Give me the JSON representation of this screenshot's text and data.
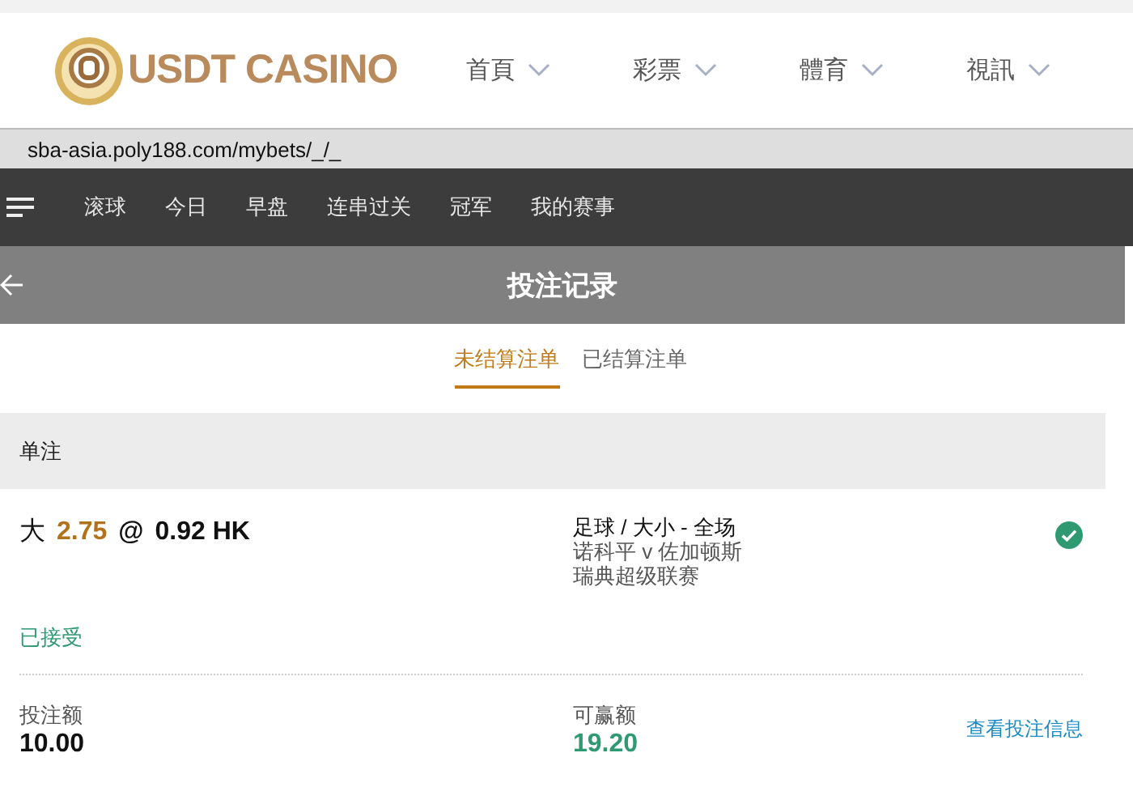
{
  "site_header": {
    "logo_text": "USDT CASINO",
    "menu": [
      {
        "label": "首頁"
      },
      {
        "label": "彩票"
      },
      {
        "label": "體育"
      },
      {
        "label": "視訊"
      }
    ]
  },
  "address_bar": {
    "url": "sba-asia.poly188.com/mybets/_/_"
  },
  "sport_nav": {
    "items": [
      {
        "label": "滚球"
      },
      {
        "label": "今日"
      },
      {
        "label": "早盘"
      },
      {
        "label": "连串过关"
      },
      {
        "label": "冠军"
      },
      {
        "label": "我的赛事"
      }
    ]
  },
  "page_title": "投注记录",
  "tabs": [
    {
      "label": "未结算注单",
      "selected": true
    },
    {
      "label": "已结算注单",
      "selected": false
    }
  ],
  "section_title": "单注",
  "bet": {
    "selection": "大",
    "handicap": "2.75",
    "at": "@",
    "odds": "0.92 HK",
    "market": "足球 / 大小 - 全场",
    "match": "诺科平 v 佐加顿斯",
    "league": "瑞典超级联赛",
    "status": "已接受",
    "accepted": true,
    "stake_label": "投注额",
    "stake": "10.00",
    "win_label": "可赢额",
    "win": "19.20",
    "details_link": "查看投注信息"
  }
}
